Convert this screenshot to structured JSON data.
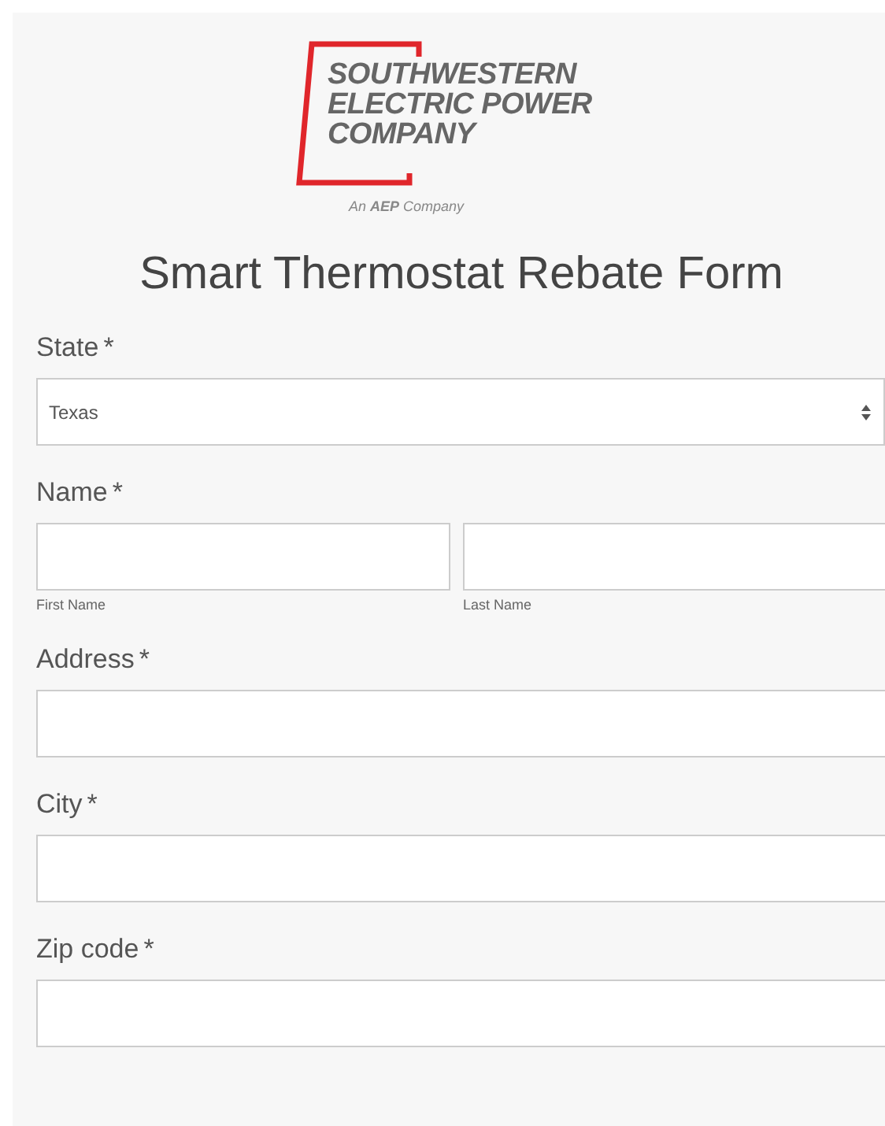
{
  "logo": {
    "lines": [
      "SOUTHWESTERN",
      "ELECTRIC POWER",
      "COMPANY"
    ],
    "tagline": "An **AEP** Company"
  },
  "title": "Smart Thermostat Rebate Form",
  "fields": [
    {
      "kind": "select",
      "label": "State",
      "required_mark": "*",
      "value": "Texas"
    },
    {
      "kind": "name",
      "label": "Name",
      "required_mark": "*",
      "parts": [
        {
          "caption": "First Name"
        },
        {
          "caption": "Last Name"
        }
      ]
    },
    {
      "kind": "text",
      "label": "Address",
      "required_mark": "*"
    },
    {
      "kind": "text",
      "label": "City",
      "required_mark": "*"
    },
    {
      "kind": "text",
      "label": "Zip code",
      "required_mark": "*"
    }
  ]
}
